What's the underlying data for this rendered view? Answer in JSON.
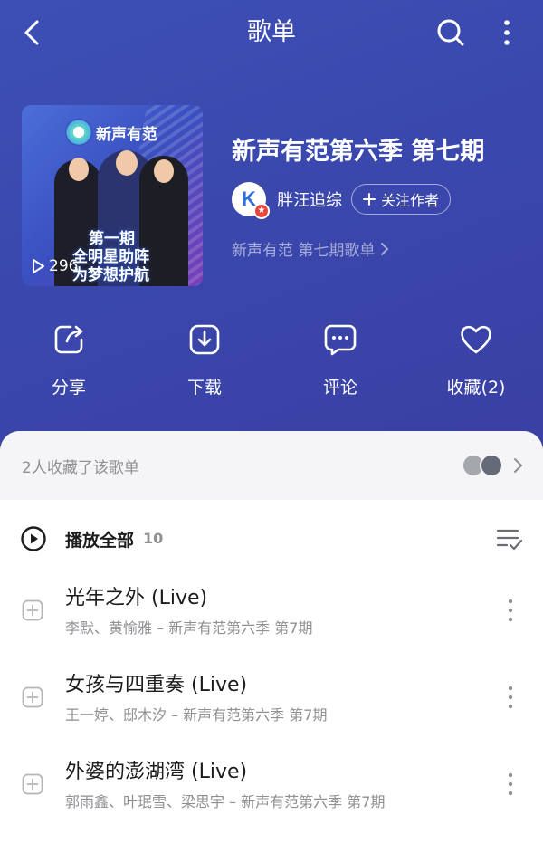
{
  "header": {
    "title": "歌单"
  },
  "playlist": {
    "title": "新声有范第六季 第七期",
    "author": "胖汪追综",
    "follow_label": "关注作者",
    "album_link": "新声有范 第七期歌单",
    "cover": {
      "logo_text": "新声有范",
      "slogan_line1": "第一期",
      "slogan_line2": "全明星助阵",
      "slogan_line3": "为梦想护航",
      "plays": "296"
    }
  },
  "actions": [
    {
      "label": "分享",
      "icon": "share-icon"
    },
    {
      "label": "下载",
      "icon": "download-icon"
    },
    {
      "label": "评论",
      "icon": "comment-icon"
    },
    {
      "label": "收藏(2)",
      "icon": "heart-icon"
    }
  ],
  "collectors": {
    "text": "2人收藏了该歌单"
  },
  "play_all": {
    "label": "播放全部",
    "count": "10"
  },
  "songs": [
    {
      "name": "光年之外 (Live)",
      "meta": "李默、黄愉雅 – 新声有范第六季 第7期"
    },
    {
      "name": "女孩与四重奏 (Live)",
      "meta": "王一婷、邸木汐 – 新声有范第六季 第7期"
    },
    {
      "name": "外婆的澎湖湾 (Live)",
      "meta": "郭雨鑫、叶珉雪、梁思宇 – 新声有范第六季 第7期"
    }
  ],
  "colors": {
    "header_bg": "#3a48ad",
    "accent_red": "#e4463b",
    "text_secondary": "#8f8f94"
  }
}
